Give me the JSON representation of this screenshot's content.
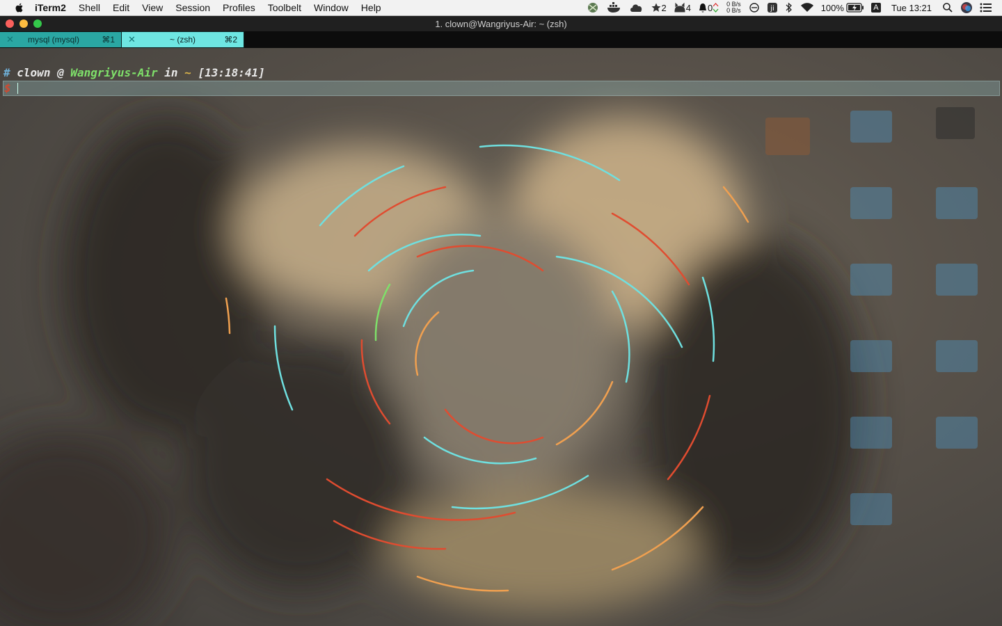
{
  "menubar": {
    "app_name": "iTerm2",
    "menus": [
      "Shell",
      "Edit",
      "View",
      "Session",
      "Profiles",
      "Toolbelt",
      "Window",
      "Help"
    ],
    "tray": {
      "stars_count": "2",
      "forks_count": "4",
      "notifications_count": "0",
      "net_up": "0 B/s",
      "net_down": "0 B/s",
      "battery": "100%",
      "input_source": "A",
      "clock": "Tue 13:21"
    }
  },
  "window": {
    "title": "1. clown@Wangriyus-Air: ~ (zsh)",
    "tabs": [
      {
        "label": "mysql (mysql)",
        "shortcut": "⌘1",
        "active": false
      },
      {
        "label": "~ (zsh)",
        "shortcut": "⌘2",
        "active": true
      }
    ]
  },
  "terminal": {
    "prompt": {
      "hash": "#",
      "user": "clown",
      "at": "@",
      "host": "Wangriyus-Air",
      "in": "in",
      "dir": "~",
      "time": "[13:18:41]",
      "symbol": "$"
    }
  },
  "colors": {
    "tab_inactive": "#2aa7a3",
    "tab_active": "#6ee6e2",
    "prompt_host": "#7fe06a",
    "prompt_dir": "#d8b24a",
    "prompt_symbol": "#d0492f"
  }
}
